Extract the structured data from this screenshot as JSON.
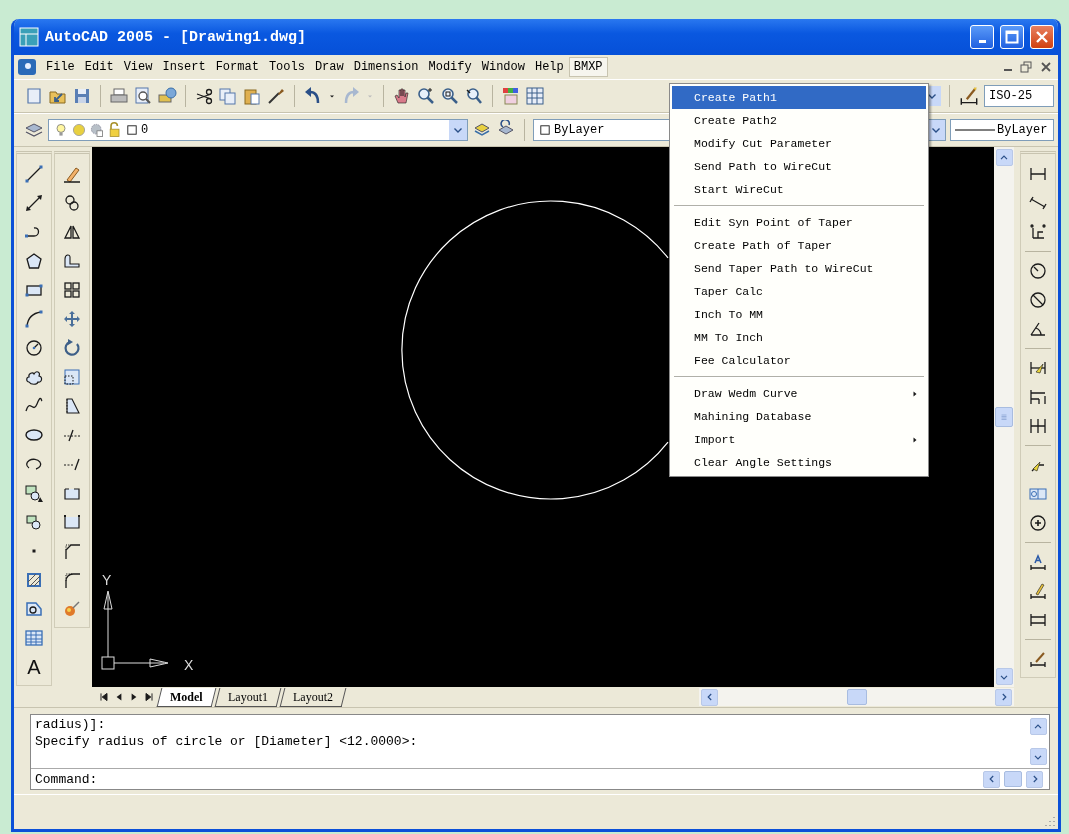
{
  "window": {
    "title": "AutoCAD 2005 - [Drawing1.dwg]"
  },
  "menu_bar": [
    {
      "label": "File",
      "selected": false
    },
    {
      "label": "Edit",
      "selected": false
    },
    {
      "label": "View",
      "selected": false
    },
    {
      "label": "Insert",
      "selected": false
    },
    {
      "label": "Format",
      "selected": false
    },
    {
      "label": "Tools",
      "selected": false
    },
    {
      "label": "Draw",
      "selected": false
    },
    {
      "label": "Dimension",
      "selected": false
    },
    {
      "label": "Modify",
      "selected": false
    },
    {
      "label": "Window",
      "selected": false
    },
    {
      "label": "Help",
      "selected": false
    },
    {
      "label": "BMXP",
      "selected": true
    }
  ],
  "open_menu": {
    "groups": [
      [
        {
          "label": "Create Path1",
          "selected": true,
          "submenu": false
        },
        {
          "label": "Create Path2",
          "selected": false,
          "submenu": false
        },
        {
          "label": "Modify Cut Parameter",
          "selected": false,
          "submenu": false
        },
        {
          "label": "Send Path to WireCut",
          "selected": false,
          "submenu": false
        },
        {
          "label": "Start WireCut",
          "selected": false,
          "submenu": false
        }
      ],
      [
        {
          "label": "Edit Syn Point of Taper",
          "selected": false,
          "submenu": false
        },
        {
          "label": "Create Path of Taper",
          "selected": false,
          "submenu": false
        },
        {
          "label": "Send Taper Path to WireCut",
          "selected": false,
          "submenu": false
        },
        {
          "label": "Taper Calc",
          "selected": false,
          "submenu": false
        },
        {
          "label": "Inch To MM",
          "selected": false,
          "submenu": false
        },
        {
          "label": "MM To Inch",
          "selected": false,
          "submenu": false
        },
        {
          "label": "Fee Calculator",
          "selected": false,
          "submenu": false
        }
      ],
      [
        {
          "label": "Draw Wedm Curve",
          "selected": false,
          "submenu": true
        },
        {
          "label": "Mahining Database",
          "selected": false,
          "submenu": false
        },
        {
          "label": "Import",
          "selected": false,
          "submenu": true
        },
        {
          "label": "Clear Angle Settings",
          "selected": false,
          "submenu": false
        }
      ]
    ]
  },
  "toolbar": {
    "dim_style": "ISO-25"
  },
  "properties_bar": {
    "layer": "0",
    "color_setting": "ByLayer",
    "lineweight": "ByLayer"
  },
  "draw_toolbar": {
    "text_tool": "A"
  },
  "canvas": {
    "x_axis_label": "X",
    "y_axis_label": "Y"
  },
  "layout_tabs": [
    {
      "label": "Model",
      "selected": true
    },
    {
      "label": "Layout1",
      "selected": false
    },
    {
      "label": "Layout2",
      "selected": false
    }
  ],
  "command_window": {
    "history": [
      "radius)]:",
      "Specify radius of circle or [Diameter] <12.0000>:"
    ],
    "prompt": "Command:"
  }
}
